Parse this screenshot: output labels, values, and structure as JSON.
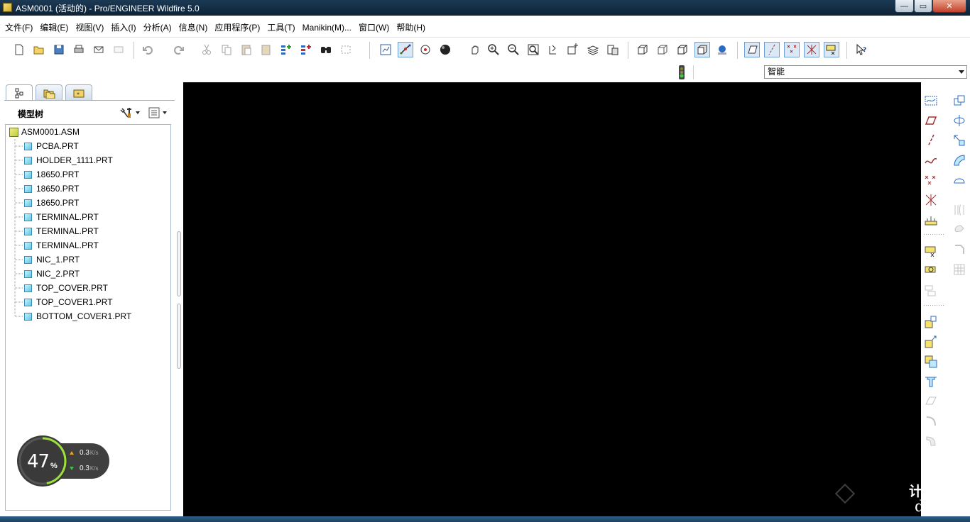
{
  "window": {
    "title": "ASM0001 (活动的) - Pro/ENGINEER Wildfire 5.0",
    "minimize_label": "—",
    "maximize_label": "▭",
    "close_label": "✕"
  },
  "menu": [
    "文件(F)",
    "编辑(E)",
    "视图(V)",
    "插入(I)",
    "分析(A)",
    "信息(N)",
    "应用程序(P)",
    "工具(T)",
    "Manikin(M)...",
    "窗口(W)",
    "帮助(H)"
  ],
  "toolbar": {
    "icons": [
      "new-icon",
      "open-icon",
      "save-icon",
      "print-icon",
      "send-mail-icon",
      "send-attachment-icon",
      "undo-icon",
      "redo-icon",
      "cut-icon",
      "copy-icon",
      "paste-icon",
      "paste-special-icon",
      "regenerate-icon",
      "regen-manager-icon",
      "find-icon",
      "select-box-icon",
      "redraw-icon",
      "spin-center-icon",
      "orient-mode-icon",
      "display-style-icon",
      "pan-icon",
      "zoom-in-icon",
      "zoom-out-icon",
      "refit-icon",
      "reorient-icon",
      "saved-views-icon",
      "layers-icon",
      "view-manager-icon",
      "wireframe-icon",
      "hidden-line-icon",
      "no-hidden-icon",
      "shading-icon",
      "enhanced-realism-icon",
      "datum-planes-icon",
      "datum-axes-icon",
      "datum-points-icon",
      "csys-icon",
      "annotation-icon",
      "whats-this-icon"
    ]
  },
  "filter": {
    "value": "智能",
    "status_icon": "traffic-light-icon"
  },
  "model_tree": {
    "tabs": [
      "model-tree-tab-icon",
      "folder-browser-tab-icon",
      "favorites-tab-icon"
    ],
    "title": "模型树",
    "root": "ASM0001.ASM",
    "items": [
      "PCBA.PRT",
      "HOLDER_1111.PRT",
      "18650.PRT",
      "18650.PRT",
      "18650.PRT",
      "TERMINAL.PRT",
      "TERMINAL.PRT",
      "TERMINAL.PRT",
      "NIC_1.PRT",
      "NIC_2.PRT",
      "TOP_COVER.PRT",
      "TOP_COVER1.PRT",
      "BOTTOM_COVER1.PRT"
    ]
  },
  "net_widget": {
    "percent": "47",
    "percent_sign": "%",
    "up_value": "0.3",
    "down_value": "0.3",
    "unit": "K/s",
    "colors": {
      "up": "#f0a020",
      "down": "#40c040"
    }
  },
  "watermark": {
    "line1": "计论坛",
    "line2": "d.com"
  },
  "right_toolbar": {
    "icons": [
      "sketch-icon",
      "datum-plane-icon",
      "datum-axis-icon",
      "datum-curve-icon",
      "datum-point-icon",
      "offset-csys-icon",
      "analysis-feature-icon",
      "assemble-icon",
      "create-component-icon",
      "repeat-component-icon",
      "pattern-icon",
      "explode-icon",
      "mirror-component-icon",
      "hole-icon",
      "shell-icon",
      "rib-icon",
      "draft-icon",
      "round-icon",
      "chamfer-icon",
      "extrude-icon",
      "revolve-icon",
      "sweep-icon",
      "blend-icon",
      "fill-icon",
      "merge-icon",
      "trim-icon"
    ]
  }
}
